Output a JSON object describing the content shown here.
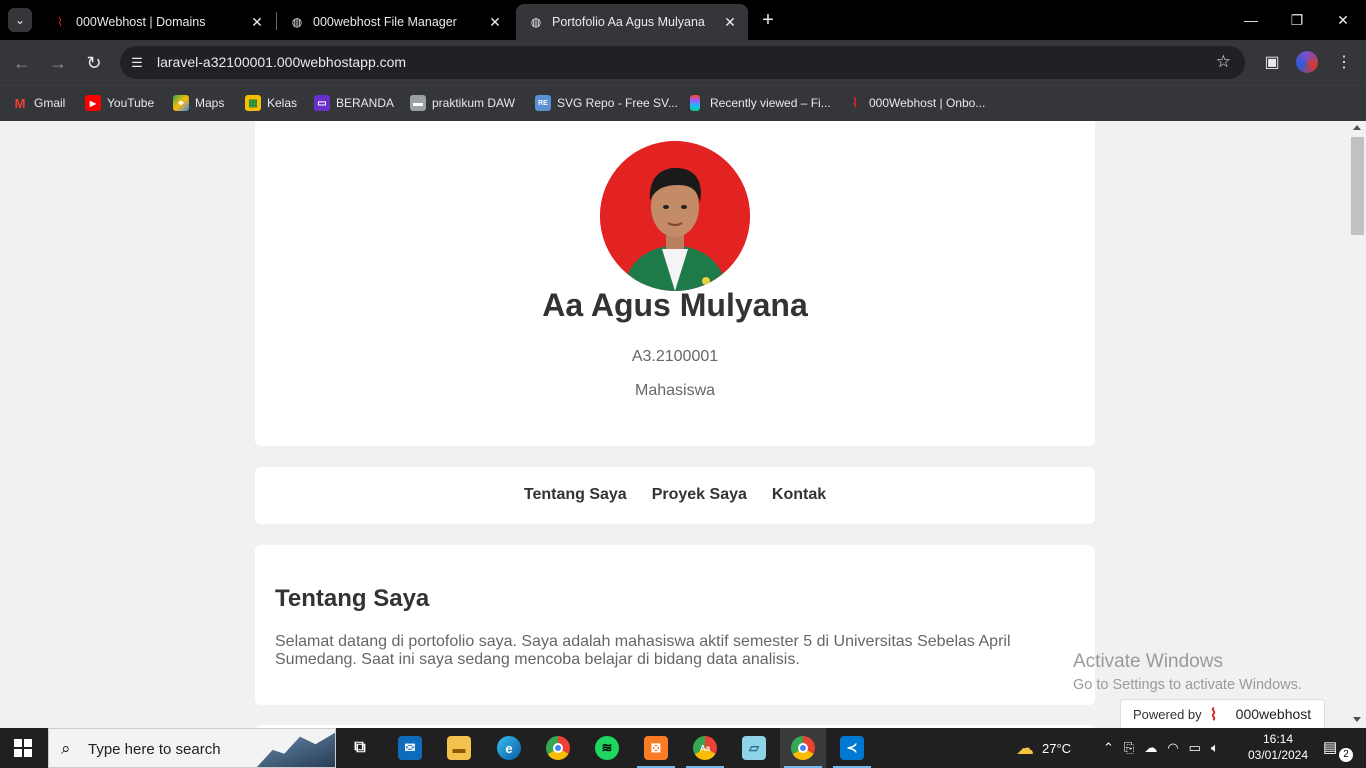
{
  "browser": {
    "tabs": [
      {
        "label": "000Webhost | Domains",
        "icon": "000webhost-logo-icon"
      },
      {
        "label": "000webhost File Manager",
        "icon": "globe-icon"
      },
      {
        "label": "Portofolio Aa Agus Mulyana",
        "icon": "globe-icon",
        "active": true
      }
    ],
    "url": "laravel-a32100001.000webhostapp.com",
    "bookmarks": [
      {
        "label": "Gmail",
        "icon": "gmail-icon"
      },
      {
        "label": "YouTube",
        "icon": "youtube-icon"
      },
      {
        "label": "Maps",
        "icon": "maps-icon"
      },
      {
        "label": "Kelas",
        "icon": "classroom-icon"
      },
      {
        "label": "BERANDA",
        "icon": "tv-icon"
      },
      {
        "label": "praktikum DAW",
        "icon": "folder-icon"
      },
      {
        "label": "SVG Repo - Free SV...",
        "icon": "svgrepo-icon"
      },
      {
        "label": "Recently viewed – Fi...",
        "icon": "figma-icon"
      },
      {
        "label": "000Webhost | Onbo...",
        "icon": "000webhost-logo-icon"
      }
    ]
  },
  "profile": {
    "name": "Aa Agus Mulyana",
    "nim": "A3.2100001",
    "role": "Mahasiswa"
  },
  "nav": {
    "links": [
      "Tentang Saya",
      "Proyek Saya",
      "Kontak"
    ]
  },
  "about": {
    "heading": "Tentang Saya",
    "text": "Selamat datang di portofolio saya. Saya adalah mahasiswa aktif semester 5 di Universitas Sebelas April Sumedang. Saat ini saya sedang mencoba belajar di bidang data analisis."
  },
  "watermark": {
    "line1": "Activate Windows",
    "line2": "Go to Settings to activate Windows."
  },
  "powered": {
    "label": "Powered by",
    "brand": "000webhost"
  },
  "taskbar": {
    "search_placeholder": "Type here to search",
    "weather": "27°C",
    "time": "16:14",
    "date": "03/01/2024",
    "notifications": "2"
  },
  "colors": {
    "accent_red": "#e32222",
    "text_dark": "#333333",
    "text_muted": "#666666"
  }
}
